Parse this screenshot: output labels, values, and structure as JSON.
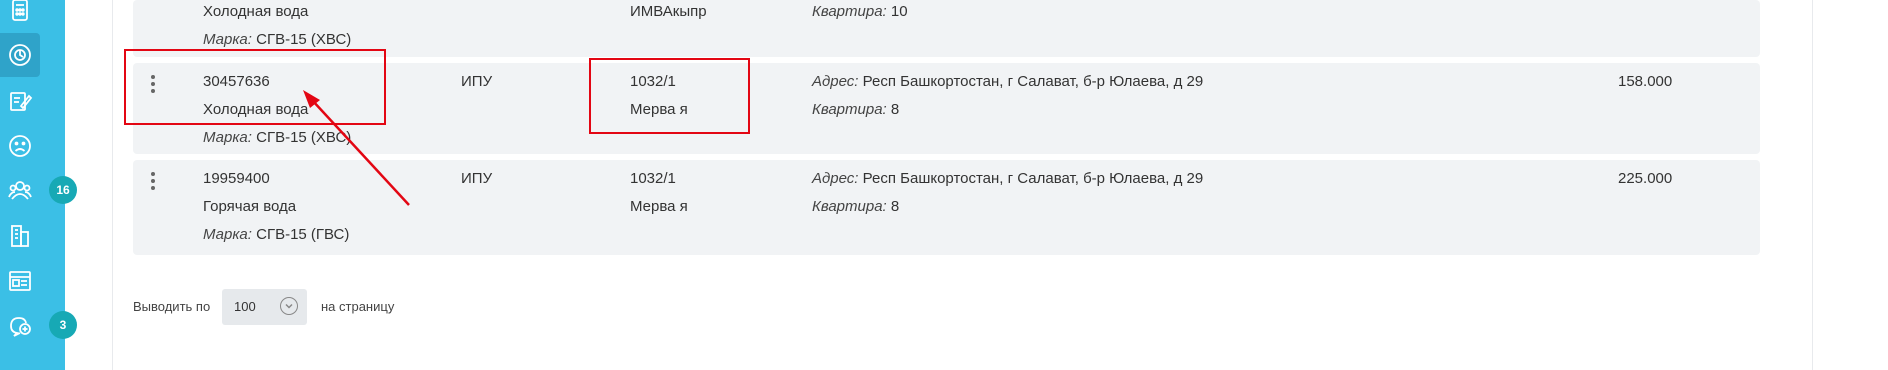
{
  "sidebar": {
    "items": [
      {
        "icon": "calculator-icon"
      },
      {
        "icon": "meter-gauge-icon",
        "active": true
      },
      {
        "icon": "edit-document-icon"
      },
      {
        "icon": "sad-face-icon"
      },
      {
        "icon": "users-group-icon",
        "badge": "16"
      },
      {
        "icon": "building-icon"
      },
      {
        "icon": "window-layout-icon"
      },
      {
        "icon": "chat-add-icon",
        "badge": "3"
      }
    ]
  },
  "rows": [
    {
      "number": "",
      "resource": "Холодная вода",
      "brand_label": "Марка:",
      "brand": "СГВ-15 (ХВС)",
      "type": "",
      "account": "",
      "owner": "ИМВАкыпр",
      "address_label": "",
      "address": "",
      "apartment_label": "Квартира:",
      "apartment": "10",
      "value": ""
    },
    {
      "number": "30457636",
      "resource": "Холодная вода",
      "brand_label": "Марка:",
      "brand": "СГВ-15 (ХВС)",
      "type": "ИПУ",
      "account": "1032/1",
      "owner": "Мерва я",
      "address_label": "Адрес:",
      "address": "Респ Башкортостан, г Салават, б-р Юлаева, д 29",
      "apartment_label": "Квартира:",
      "apartment": "8",
      "value": "158.000"
    },
    {
      "number": "19959400",
      "resource": "Горячая вода",
      "brand_label": "Марка:",
      "brand": "СГВ-15 (ГВС)",
      "type": "ИПУ",
      "account": "1032/1",
      "owner": "Мерва я",
      "address_label": "Адрес:",
      "address": "Респ Башкортостан, г Салават, б-р Юлаева, д 29",
      "apartment_label": "Квартира:",
      "apartment": "8",
      "value": "225.000"
    }
  ],
  "pager": {
    "prefix": "Выводить по",
    "page_size": "100",
    "suffix": "на страницу"
  },
  "colors": {
    "sidebar": "#3bbfe6",
    "badge": "#17a9b5",
    "annotation": "#e30613",
    "row_bg": "#f1f3f5"
  }
}
